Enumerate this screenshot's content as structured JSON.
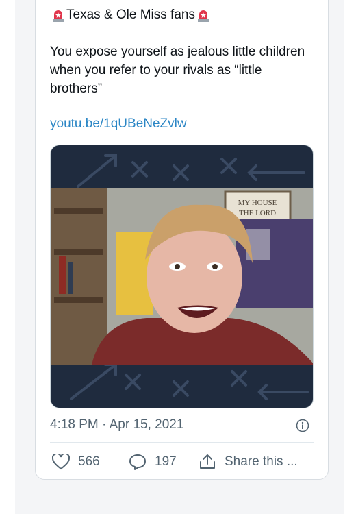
{
  "tweet": {
    "headline": "Texas & Ole Miss fans",
    "body": "You expose yourself as jealous little children when you refer to your rivals as “little brothers”",
    "link": "youtu.be/1qUBeNeZvlw",
    "media": {
      "banner_text": "MY HOUSE\nTHE LORD"
    },
    "timestamp": "4:18 PM · Apr 15, 2021",
    "actions": {
      "likes": "566",
      "replies": "197",
      "share_label": "Share this ..."
    }
  },
  "colors": {
    "link": "#2b86c5",
    "meta_text": "#536471",
    "media_bg": "#1f2b3e"
  },
  "icons": [
    "siren-emoji-icon",
    "heart-icon",
    "reply-bubble-icon",
    "share-icon",
    "info-icon"
  ]
}
